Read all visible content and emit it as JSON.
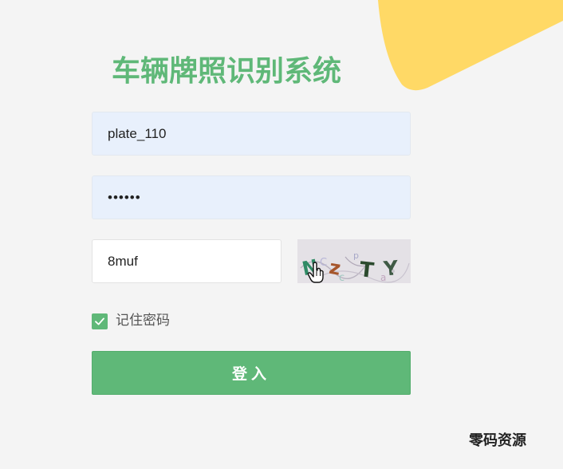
{
  "title": "车辆牌照识别系统",
  "form": {
    "username_value": "plate_110",
    "password_value": "••••••",
    "captcha_value": "8muf",
    "captcha_image_text": "NzTY",
    "remember_label": "记住密码",
    "remember_checked": true,
    "login_label": "登入"
  },
  "watermark": "零码资源",
  "colors": {
    "accent": "#5fb878",
    "blob": "#ffd966",
    "input_fill": "#e8f0fc",
    "background": "#f4f4f4"
  },
  "icons": {
    "checkbox": "check-icon",
    "cursor": "hand-pointer-icon"
  }
}
